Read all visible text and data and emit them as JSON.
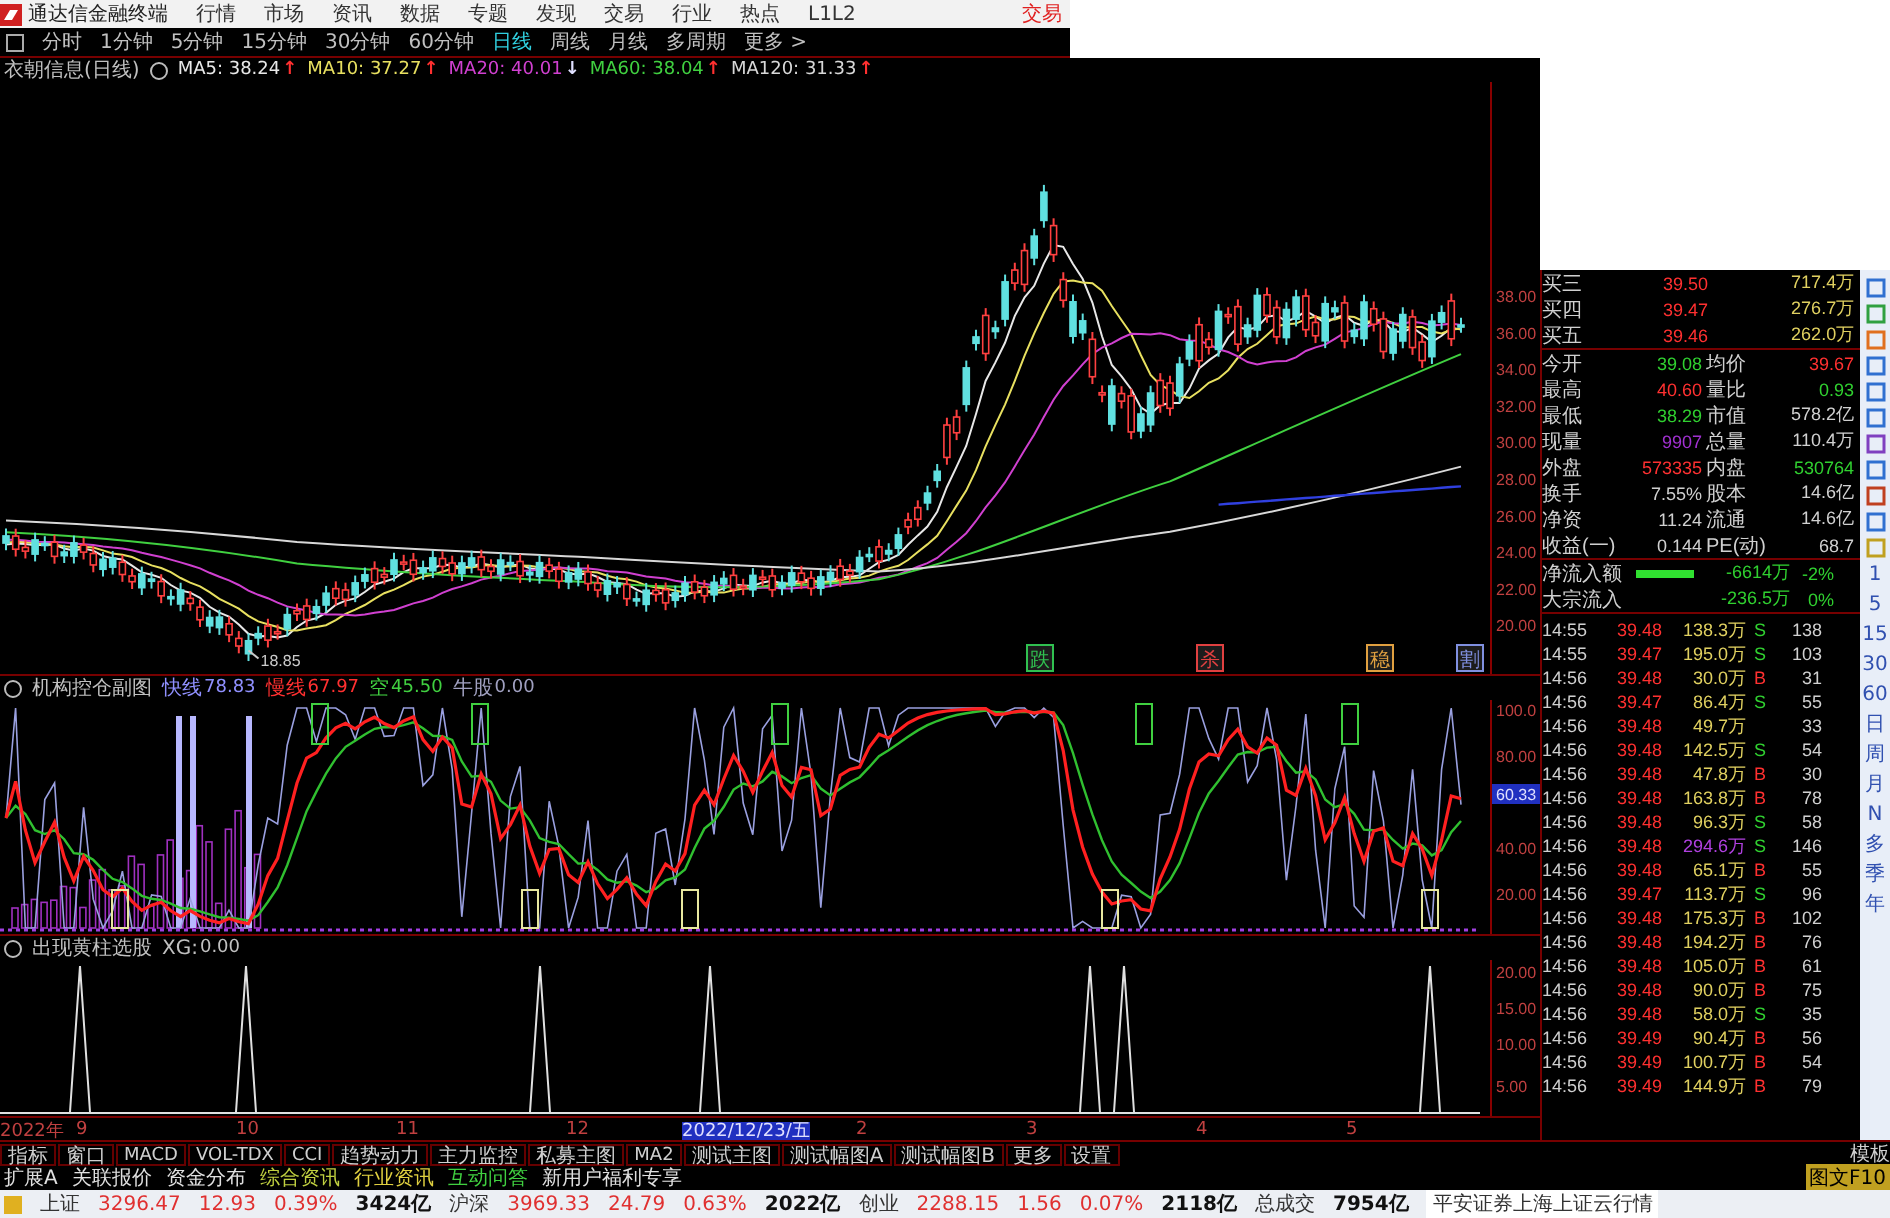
{
  "menu_bar": {
    "app_title": "通达信金融终端",
    "items": [
      "行情",
      "市场",
      "资讯",
      "数据",
      "专题",
      "发现",
      "交易",
      "行业",
      "热点",
      "L1L2"
    ],
    "trade_button": "交易"
  },
  "period_bar": {
    "items": [
      {
        "label": "分时",
        "selected": false
      },
      {
        "label": "1分钟",
        "selected": false
      },
      {
        "label": "5分钟",
        "selected": false
      },
      {
        "label": "15分钟",
        "selected": false
      },
      {
        "label": "30分钟",
        "selected": false
      },
      {
        "label": "60分钟",
        "selected": false
      },
      {
        "label": "日线",
        "selected": true
      },
      {
        "label": "周线",
        "selected": false
      },
      {
        "label": "月线",
        "selected": false
      },
      {
        "label": "多周期",
        "selected": false
      },
      {
        "label": "更多 >",
        "selected": false
      }
    ]
  },
  "main_chart": {
    "title": "衣朝信息(日线)",
    "indicators": [
      {
        "label": "MA5: 38.24",
        "color": "#e8e8e8",
        "arrow": "↑",
        "rising": true
      },
      {
        "label": "MA10: 37.27",
        "color": "#e8e060",
        "arrow": "↑",
        "rising": true
      },
      {
        "label": "MA20: 40.01",
        "color": "#d040d0",
        "arrow": "↓",
        "rising": false
      },
      {
        "label": "MA60: 38.04",
        "color": "#40d040",
        "arrow": "↑",
        "rising": true
      },
      {
        "label": "MA120: 31.33",
        "color": "#d8d8d8",
        "arrow": "↑",
        "rising": true
      }
    ],
    "axis_labels": [
      "38.00",
      "36.00",
      "34.00",
      "32.00",
      "30.00",
      "28.00",
      "26.00",
      "24.00",
      "22.00",
      "20.00"
    ],
    "low_label": "18.85",
    "signals": [
      {
        "label": "跌",
        "color": "#30c050"
      },
      {
        "label": "杀",
        "color": "#e04040"
      },
      {
        "label": "稳",
        "color": "#e0a040"
      },
      {
        "label": "割",
        "color": "#8090e0"
      }
    ]
  },
  "indicator_1": {
    "title": "机构控仓副图",
    "values": [
      {
        "name": "快线",
        "value": "78.83",
        "color": "#9090ff"
      },
      {
        "name": "慢线",
        "value": "67.97",
        "color": "#ff3030"
      },
      {
        "name": "空",
        "value": "45.50",
        "color": "#40d040"
      },
      {
        "name": "牛股",
        "value": "0.00",
        "color": "#a0a0c0"
      }
    ],
    "axis_labels": [
      "100.0",
      "80.00",
      "60.33",
      "40.00",
      "20.00"
    ]
  },
  "indicator_2": {
    "title": "出现黄柱选股",
    "values": [
      {
        "name": "XG:",
        "value": "0.00",
        "color": "#c0c0c0"
      }
    ],
    "axis_labels": [
      "20.00",
      "15.00",
      "10.00",
      "5.00"
    ]
  },
  "date_axis": [
    {
      "label": "2022年",
      "selected": false
    },
    {
      "label": "9",
      "selected": false
    },
    {
      "label": "10",
      "selected": false
    },
    {
      "label": "11",
      "selected": false
    },
    {
      "label": "12",
      "selected": false
    },
    {
      "label": "2022/12/23/五",
      "selected": true
    },
    {
      "label": "2",
      "selected": false
    },
    {
      "label": "3",
      "selected": false
    },
    {
      "label": "4",
      "selected": false
    },
    {
      "label": "5",
      "selected": false
    }
  ],
  "quote": {
    "order_book": [
      {
        "label": "买三",
        "price": "39.50",
        "volume": "717.4万"
      },
      {
        "label": "买四",
        "price": "39.47",
        "volume": "276.7万"
      },
      {
        "label": "买五",
        "price": "39.46",
        "volume": "262.0万"
      }
    ],
    "stats": [
      [
        {
          "text": "今开",
          "color": "#d0d0d0"
        },
        {
          "text": "39.08",
          "color": "#30d030"
        },
        {
          "text": "均价",
          "color": "#d0d0d0"
        },
        {
          "text": "39.67",
          "color": "#ff3030"
        }
      ],
      [
        {
          "text": "最高",
          "color": "#d0d0d0"
        },
        {
          "text": "40.60",
          "color": "#ff3030"
        },
        {
          "text": "量比",
          "color": "#d0d0d0"
        },
        {
          "text": "0.93",
          "color": "#30d030"
        }
      ],
      [
        {
          "text": "最低",
          "color": "#d0d0d0"
        },
        {
          "text": "38.29",
          "color": "#30d030"
        },
        {
          "text": "市值",
          "color": "#d0d0d0"
        },
        {
          "text": "578.2亿",
          "color": "#d0d0d0"
        }
      ],
      [
        {
          "text": "现量",
          "color": "#d0d0d0"
        },
        {
          "text": "9907",
          "color": "#a030d0"
        },
        {
          "text": "总量",
          "color": "#d0d0d0"
        },
        {
          "text": "110.4万",
          "color": "#d0d0d0"
        }
      ],
      [
        {
          "text": "外盘",
          "color": "#d0d0d0"
        },
        {
          "text": "573335",
          "color": "#ff3030"
        },
        {
          "text": "内盘",
          "color": "#d0d0d0"
        },
        {
          "text": "530764",
          "color": "#30d030"
        }
      ],
      [
        {
          "text": "换手",
          "color": "#d0d0d0"
        },
        {
          "text": "7.55%",
          "color": "#d0d0d0"
        },
        {
          "text": "股本",
          "color": "#d0d0d0"
        },
        {
          "text": "14.6亿",
          "color": "#d0d0d0"
        }
      ],
      [
        {
          "text": "净资",
          "color": "#d0d0d0"
        },
        {
          "text": "11.24",
          "color": "#d0d0d0"
        },
        {
          "text": "流通",
          "color": "#d0d0d0"
        },
        {
          "text": "14.6亿",
          "color": "#d0d0d0"
        }
      ],
      [
        {
          "text": "收益(一)",
          "color": "#d0d0d0"
        },
        {
          "text": "0.144",
          "color": "#d0d0d0"
        },
        {
          "text": "PE(动)",
          "color": "#d0d0d0"
        },
        {
          "text": "68.7",
          "color": "#d0d0d0"
        }
      ]
    ],
    "flows": [
      {
        "label": "净流入额",
        "level": 0.85,
        "value": "-6614万",
        "pct": "-2%"
      },
      {
        "label": "大宗流入",
        "value": "-236.5万",
        "pct": "0%"
      }
    ],
    "ticks": [
      {
        "time": "14:55",
        "price": "39.48",
        "volume": "138.3万",
        "side": "S",
        "count": "138",
        "large": false
      },
      {
        "time": "14:55",
        "price": "39.47",
        "volume": "195.0万",
        "side": "S",
        "count": "103",
        "large": false
      },
      {
        "time": "14:56",
        "price": "39.48",
        "volume": "30.0万",
        "side": "B",
        "count": "31",
        "large": false
      },
      {
        "time": "14:56",
        "price": "39.47",
        "volume": "86.4万",
        "side": "S",
        "count": "55",
        "large": false
      },
      {
        "time": "14:56",
        "price": "39.48",
        "volume": "49.7万",
        "count": "33",
        "large": false
      },
      {
        "time": "14:56",
        "price": "39.48",
        "volume": "142.5万",
        "side": "S",
        "count": "54",
        "large": false
      },
      {
        "time": "14:56",
        "price": "39.48",
        "volume": "47.8万",
        "side": "B",
        "count": "30",
        "large": false
      },
      {
        "time": "14:56",
        "price": "39.48",
        "volume": "163.8万",
        "side": "B",
        "count": "78",
        "large": false
      },
      {
        "time": "14:56",
        "price": "39.48",
        "volume": "96.3万",
        "side": "S",
        "count": "58",
        "large": false
      },
      {
        "time": "14:56",
        "price": "39.48",
        "volume": "294.6万",
        "side": "S",
        "count": "146",
        "large": true
      },
      {
        "time": "14:56",
        "price": "39.48",
        "volume": "65.1万",
        "side": "B",
        "count": "55",
        "large": false
      },
      {
        "time": "14:56",
        "price": "39.47",
        "volume": "113.7万",
        "side": "S",
        "count": "96",
        "large": false
      },
      {
        "time": "14:56",
        "price": "39.48",
        "volume": "175.3万",
        "side": "B",
        "count": "102",
        "large": false
      },
      {
        "time": "14:56",
        "price": "39.48",
        "volume": "194.2万",
        "side": "B",
        "count": "76",
        "large": false
      },
      {
        "time": "14:56",
        "price": "39.48",
        "volume": "105.0万",
        "side": "B",
        "count": "61",
        "large": false
      },
      {
        "time": "14:56",
        "price": "39.48",
        "volume": "90.0万",
        "side": "B",
        "count": "75",
        "large": false
      },
      {
        "time": "14:56",
        "price": "39.48",
        "volume": "58.0万",
        "side": "S",
        "count": "35",
        "large": false
      },
      {
        "time": "14:56",
        "price": "39.49",
        "volume": "90.4万",
        "side": "B",
        "count": "56",
        "large": false
      },
      {
        "time": "14:56",
        "price": "39.49",
        "volume": "100.7万",
        "side": "B",
        "count": "54",
        "large": false
      },
      {
        "time": "14:56",
        "price": "39.49",
        "volume": "144.9万",
        "side": "B",
        "count": "79",
        "large": false
      }
    ]
  },
  "side_toolbar": {
    "periods": [
      "1",
      "5",
      "15",
      "30",
      "60",
      "日",
      "周",
      "月",
      "N",
      "多",
      "季",
      "年"
    ]
  },
  "bottom_tabs": {
    "items": [
      "指标",
      "窗口",
      "MACD",
      "VOL-TDX",
      "CCI",
      "趋势动力",
      "主力监控",
      "私募主图",
      "MA2",
      "测试主图",
      "测试幅图A",
      "测试幅图B",
      "更多",
      "设置"
    ],
    "template_button": "模板"
  },
  "info_tabs": {
    "items": [
      {
        "label": "扩展A",
        "color": "#e0e0e0"
      },
      {
        "label": "关联报价",
        "color": "#e0e0e0"
      },
      {
        "label": "资金分布",
        "color": "#e0e0e0"
      },
      {
        "label": "综合资讯",
        "color": "#c0d040"
      },
      {
        "label": "行业资讯",
        "color": "#e0d040"
      },
      {
        "label": "互动问答",
        "color": "#40d040"
      },
      {
        "label": "新用户福利专享",
        "color": "#e0e0e0"
      }
    ],
    "f10_button": "图文F10"
  },
  "status_bar": {
    "indices": [
      {
        "name": "上证",
        "value": "3296.47",
        "change": "12.93",
        "pct": "0.39%",
        "amount": "3424亿"
      },
      {
        "name": "沪深",
        "value": "3969.33",
        "change": "24.79",
        "pct": "0.63%",
        "amount": "2022亿"
      },
      {
        "name": "创业",
        "value": "2288.15",
        "change": "1.56",
        "pct": "0.07%",
        "amount": "2118亿"
      }
    ],
    "total_label": "总成交",
    "total_value": "7954亿",
    "server": "平安证券上海上证云行情"
  }
}
